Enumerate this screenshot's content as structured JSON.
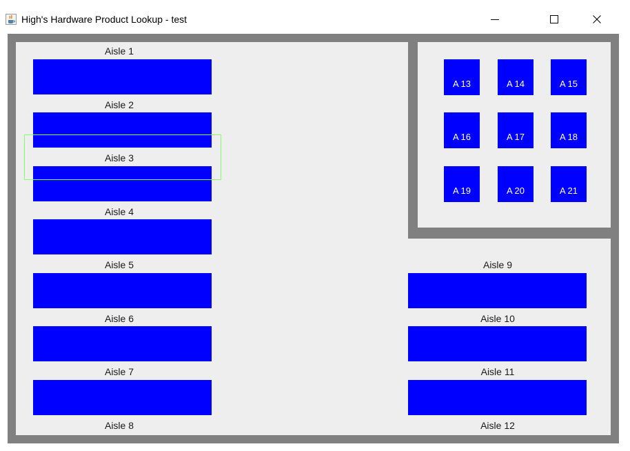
{
  "window": {
    "title": "High's Hardware Product Lookup - test",
    "icon": "java-coffee-cup-icon",
    "controls": [
      "minimize-icon",
      "maximize-icon",
      "close-icon"
    ]
  },
  "colors": {
    "aisle_fill": "#0000ff",
    "wall": "#808080",
    "floor": "#eeeeee",
    "selection_outline": "#7fff6a"
  },
  "aisles": [
    {
      "label": "Aisle 1"
    },
    {
      "label": "Aisle 2"
    },
    {
      "label": "Aisle 3"
    },
    {
      "label": "Aisle 4"
    },
    {
      "label": "Aisle 5"
    },
    {
      "label": "Aisle 6"
    },
    {
      "label": "Aisle 7"
    },
    {
      "label": "Aisle 8"
    },
    {
      "label": "Aisle 9"
    },
    {
      "label": "Aisle 10"
    },
    {
      "label": "Aisle 11"
    },
    {
      "label": "Aisle 12"
    }
  ],
  "cells": [
    {
      "label": "A 13"
    },
    {
      "label": "A 14"
    },
    {
      "label": "A 15"
    },
    {
      "label": "A 16"
    },
    {
      "label": "A 17"
    },
    {
      "label": "A 18"
    },
    {
      "label": "A 19"
    },
    {
      "label": "A 20"
    },
    {
      "label": "A 21"
    }
  ],
  "selected_aisle": "Aisle 3"
}
